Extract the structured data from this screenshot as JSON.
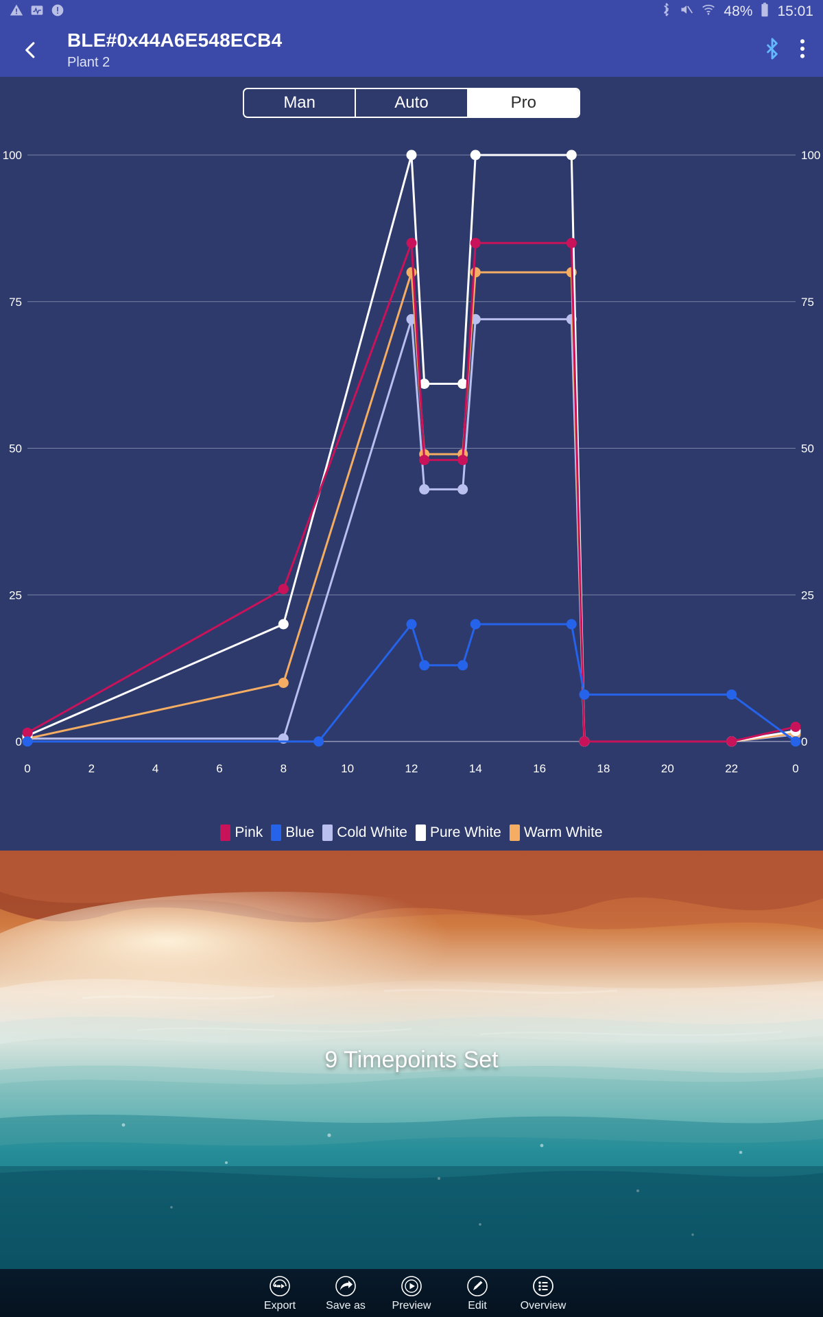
{
  "status_bar": {
    "left_icons": [
      "warning-triangle-icon",
      "chart-activity-icon",
      "exclamation-circle-icon"
    ],
    "right_icons": [
      "bluetooth-icon",
      "mute-icon",
      "wifi-icon"
    ],
    "battery_percent": "48%",
    "time": "15:01"
  },
  "app_bar": {
    "back_icon": "chevron-left-icon",
    "title": "BLE#0x44A6E548ECB4",
    "subtitle": "Plant 2",
    "bluetooth_icon": "bluetooth-icon",
    "overflow_icon": "more-vertical-icon"
  },
  "tabs": [
    {
      "label": "Man",
      "active": false
    },
    {
      "label": "Auto",
      "active": false
    },
    {
      "label": "Pro",
      "active": true
    }
  ],
  "colors": {
    "panel_bg": "#2e3a6b",
    "app_bar": "#3b49a8",
    "grid": "#b9bed6",
    "pink": "#c8135b",
    "blue": "#2563eb",
    "cold_white": "#b9c0ef",
    "pure_white": "#ffffff",
    "warm_white": "#f4ad63"
  },
  "chart_data": {
    "type": "line",
    "title": "",
    "xlabel": "",
    "ylabel": "",
    "xlim": [
      0,
      24
    ],
    "ylim": [
      0,
      100
    ],
    "grid": true,
    "legend_position": "bottom",
    "x_ticks": [
      0,
      2,
      4,
      6,
      8,
      10,
      12,
      14,
      16,
      18,
      20,
      22,
      24
    ],
    "x_tick_labels": [
      "0",
      "2",
      "4",
      "6",
      "8",
      "10",
      "12",
      "14",
      "16",
      "18",
      "20",
      "22",
      "0"
    ],
    "y_ticks": [
      0,
      25,
      50,
      75,
      100
    ],
    "y_tick_labels": [
      "0",
      "25",
      "50",
      "75",
      "100"
    ],
    "timepoints": [
      0,
      8,
      12,
      12.4,
      13.6,
      14,
      17,
      17.4,
      22,
      24
    ],
    "series": [
      {
        "name": "Pink",
        "color": "#c8135b",
        "x": [
          0,
          8,
          12,
          12.4,
          13.6,
          14,
          17,
          17.4,
          22,
          24
        ],
        "values": [
          1.5,
          26,
          85,
          48,
          48,
          85,
          85,
          0,
          0,
          2.5
        ]
      },
      {
        "name": "Blue",
        "color": "#2563eb",
        "x": [
          0,
          9.1,
          12,
          12.4,
          13.6,
          14,
          17,
          17.4,
          22,
          24
        ],
        "values": [
          0,
          0,
          20,
          13,
          13,
          20,
          20,
          8,
          8,
          0
        ]
      },
      {
        "name": "Cold White",
        "color": "#b9c0ef",
        "x": [
          0,
          8,
          12,
          12.4,
          13.6,
          14,
          17,
          17.4,
          22,
          24
        ],
        "values": [
          0.5,
          0.5,
          72,
          43,
          43,
          72,
          72,
          0,
          0,
          1.2
        ]
      },
      {
        "name": "Pure White",
        "color": "#ffffff",
        "x": [
          0,
          8,
          12,
          12.4,
          13.6,
          14,
          17,
          17.4,
          22,
          24
        ],
        "values": [
          1,
          20,
          100,
          61,
          61,
          100,
          100,
          0,
          0,
          1.8
        ]
      },
      {
        "name": "Warm White",
        "color": "#f4ad63",
        "x": [
          0,
          8,
          12,
          12.4,
          13.6,
          14,
          17,
          17.4,
          22,
          24
        ],
        "values": [
          0.5,
          10,
          80,
          49,
          49,
          80,
          80,
          0,
          0,
          1.4
        ]
      }
    ]
  },
  "hero": {
    "caption": "9 Timepoints Set"
  },
  "bottom_nav": [
    {
      "label": "Export",
      "icon": "export-arrow-icon"
    },
    {
      "label": "Save as",
      "icon": "share-arrow-icon"
    },
    {
      "label": "Preview",
      "icon": "play-circle-icon"
    },
    {
      "label": "Edit",
      "icon": "pencil-icon"
    },
    {
      "label": "Overview",
      "icon": "list-icon"
    }
  ]
}
